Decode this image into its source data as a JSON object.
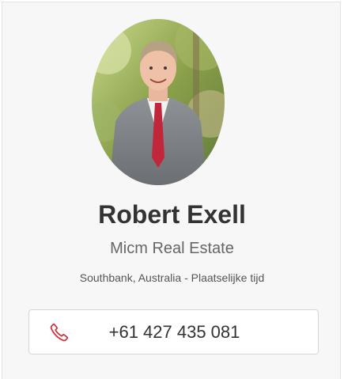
{
  "agent": {
    "name": "Robert Exell",
    "agency": "Micm Real Estate",
    "location": "Southbank, Australia - Plaatselijke tijd",
    "phone": "+61 427 435 081",
    "photo_icon": "agent-portrait"
  },
  "colors": {
    "phone_icon": "#d0313d",
    "name_text": "#333333",
    "card_background": "#f7f7f7"
  },
  "icons": {
    "phone": "phone-icon"
  }
}
